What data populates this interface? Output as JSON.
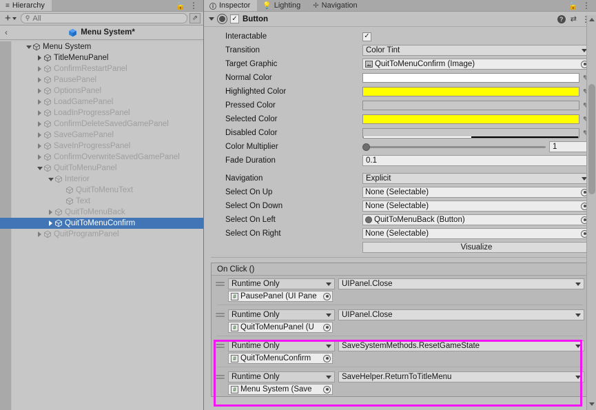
{
  "hierarchy": {
    "tab_label": "Hierarchy",
    "tab_icon": "list-icon",
    "lock_icon": "lock-open-icon",
    "menu_icon": "kebab-menu-icon",
    "toolbar": {
      "add_label": "+",
      "search_placeholder": "All",
      "search_value": "",
      "search_icon": "search-icon",
      "expand_icon": "open-in-new-icon"
    },
    "breadcrumb": {
      "back_label": "‹",
      "title": "Menu System*"
    },
    "tree": [
      {
        "label": "Menu System",
        "depth": 0,
        "fold": "down",
        "enabled": true,
        "selected": false
      },
      {
        "label": "TitleMenuPanel",
        "depth": 1,
        "fold": "right",
        "enabled": true,
        "selected": false
      },
      {
        "label": "ConfirmRestartPanel",
        "depth": 1,
        "fold": "right",
        "enabled": false,
        "selected": false
      },
      {
        "label": "PausePanel",
        "depth": 1,
        "fold": "right",
        "enabled": false,
        "selected": false
      },
      {
        "label": "OptionsPanel",
        "depth": 1,
        "fold": "right",
        "enabled": false,
        "selected": false
      },
      {
        "label": "LoadGamePanel",
        "depth": 1,
        "fold": "right",
        "enabled": false,
        "selected": false
      },
      {
        "label": "LoadInProgressPanel",
        "depth": 1,
        "fold": "right",
        "enabled": false,
        "selected": false
      },
      {
        "label": "ConfirmDeleteSavedGamePanel",
        "depth": 1,
        "fold": "right",
        "enabled": false,
        "selected": false
      },
      {
        "label": "SaveGamePanel",
        "depth": 1,
        "fold": "right",
        "enabled": false,
        "selected": false
      },
      {
        "label": "SaveInProgressPanel",
        "depth": 1,
        "fold": "right",
        "enabled": false,
        "selected": false
      },
      {
        "label": "ConfirmOverwriteSavedGamePanel",
        "depth": 1,
        "fold": "right",
        "enabled": false,
        "selected": false
      },
      {
        "label": "QuitToMenuPanel",
        "depth": 1,
        "fold": "down",
        "enabled": false,
        "selected": false
      },
      {
        "label": "Interior",
        "depth": 2,
        "fold": "down",
        "enabled": false,
        "selected": false
      },
      {
        "label": "QuitToMenuText",
        "depth": 3,
        "fold": "none",
        "enabled": false,
        "selected": false
      },
      {
        "label": "Text",
        "depth": 3,
        "fold": "none",
        "enabled": false,
        "selected": false
      },
      {
        "label": "QuitToMenuBack",
        "depth": 2,
        "fold": "right",
        "enabled": false,
        "selected": false
      },
      {
        "label": "QuitToMenuConfirm",
        "depth": 2,
        "fold": "right",
        "enabled": false,
        "selected": true
      },
      {
        "label": "QuitProgramPanel",
        "depth": 1,
        "fold": "right",
        "enabled": false,
        "selected": false
      }
    ]
  },
  "inspector": {
    "tabs": [
      {
        "label": "Inspector",
        "icon": "info-icon",
        "active": true
      },
      {
        "label": "Lighting",
        "icon": "lightbulb-icon",
        "active": false
      },
      {
        "label": "Navigation",
        "icon": "navmesh-icon",
        "active": false
      }
    ],
    "lock_icon": "lock-open-icon",
    "menu_icon": "kebab-menu-icon",
    "component": {
      "title": "Button",
      "foldout_icon": "chevron-down-icon",
      "component_icon": "button-component-icon",
      "enabled_checkbox": "✓",
      "help_icon": "help-icon",
      "preset_icon": "preset-icon",
      "menu_icon": "kebab-menu-icon"
    },
    "properties": [
      {
        "name": "interactable",
        "label": "Interactable",
        "type": "checkbox",
        "value": "✓"
      },
      {
        "name": "transition",
        "label": "Transition",
        "type": "dropdown",
        "value": "Color Tint"
      },
      {
        "name": "target-graphic",
        "label": "Target Graphic",
        "type": "object",
        "value": "QuitToMenuConfirm (Image)",
        "icon": "image-icon"
      },
      {
        "name": "normal-color",
        "label": "Normal Color",
        "type": "color",
        "value": "#FFFFFF",
        "alpha": 100
      },
      {
        "name": "highlighted-color",
        "label": "Highlighted Color",
        "type": "color",
        "value": "#FFFF00",
        "alpha": 100
      },
      {
        "name": "pressed-color",
        "label": "Pressed Color",
        "type": "color",
        "value": "#C8C8C8",
        "alpha": 100
      },
      {
        "name": "selected-color",
        "label": "Selected Color",
        "type": "color",
        "value": "#FFFF00",
        "alpha": 100
      },
      {
        "name": "disabled-color",
        "label": "Disabled Color",
        "type": "color",
        "value": "#C8C8C8",
        "alpha": 50
      },
      {
        "name": "color-multiplier",
        "label": "Color Multiplier",
        "type": "slider",
        "value": "1"
      },
      {
        "name": "fade-duration",
        "label": "Fade Duration",
        "type": "text",
        "value": "0.1"
      }
    ],
    "navigation": {
      "label": "Navigation",
      "value": "Explicit",
      "rows": [
        {
          "label": "Select On Up",
          "value": "None (Selectable)",
          "has_icon": false
        },
        {
          "label": "Select On Down",
          "value": "None (Selectable)",
          "has_icon": false
        },
        {
          "label": "Select On Left",
          "value": "QuitToMenuBack (Button)",
          "has_icon": true
        },
        {
          "label": "Select On Right",
          "value": "None (Selectable)",
          "has_icon": false
        }
      ],
      "visualize_label": "Visualize"
    },
    "onclick": {
      "title": "On Click ()",
      "events": [
        {
          "mode": "Runtime Only",
          "function": "UIPanel.Close",
          "object": "PausePanel (UI Pane",
          "highlighted": false
        },
        {
          "mode": "Runtime Only",
          "function": "UIPanel.Close",
          "object": "QuitToMenuPanel (U",
          "highlighted": false
        },
        {
          "mode": "Runtime Only",
          "function": "SaveSystemMethods.ResetGameState",
          "object": "QuitToMenuConfirm",
          "highlighted": true
        },
        {
          "mode": "Runtime Only",
          "function": "SaveHelper.ReturnToTitleMenu",
          "object": "Menu System (Save",
          "highlighted": true
        }
      ]
    },
    "scrollbar": {
      "up_icon": "triangle-up-icon",
      "down_icon": "triangle-down-icon"
    }
  },
  "colors": {
    "selection_blue": "#4275b5",
    "highlight_magenta": "#f514f5",
    "panel_bg": "#c2c2c2",
    "yellow": "#FFFF00"
  }
}
